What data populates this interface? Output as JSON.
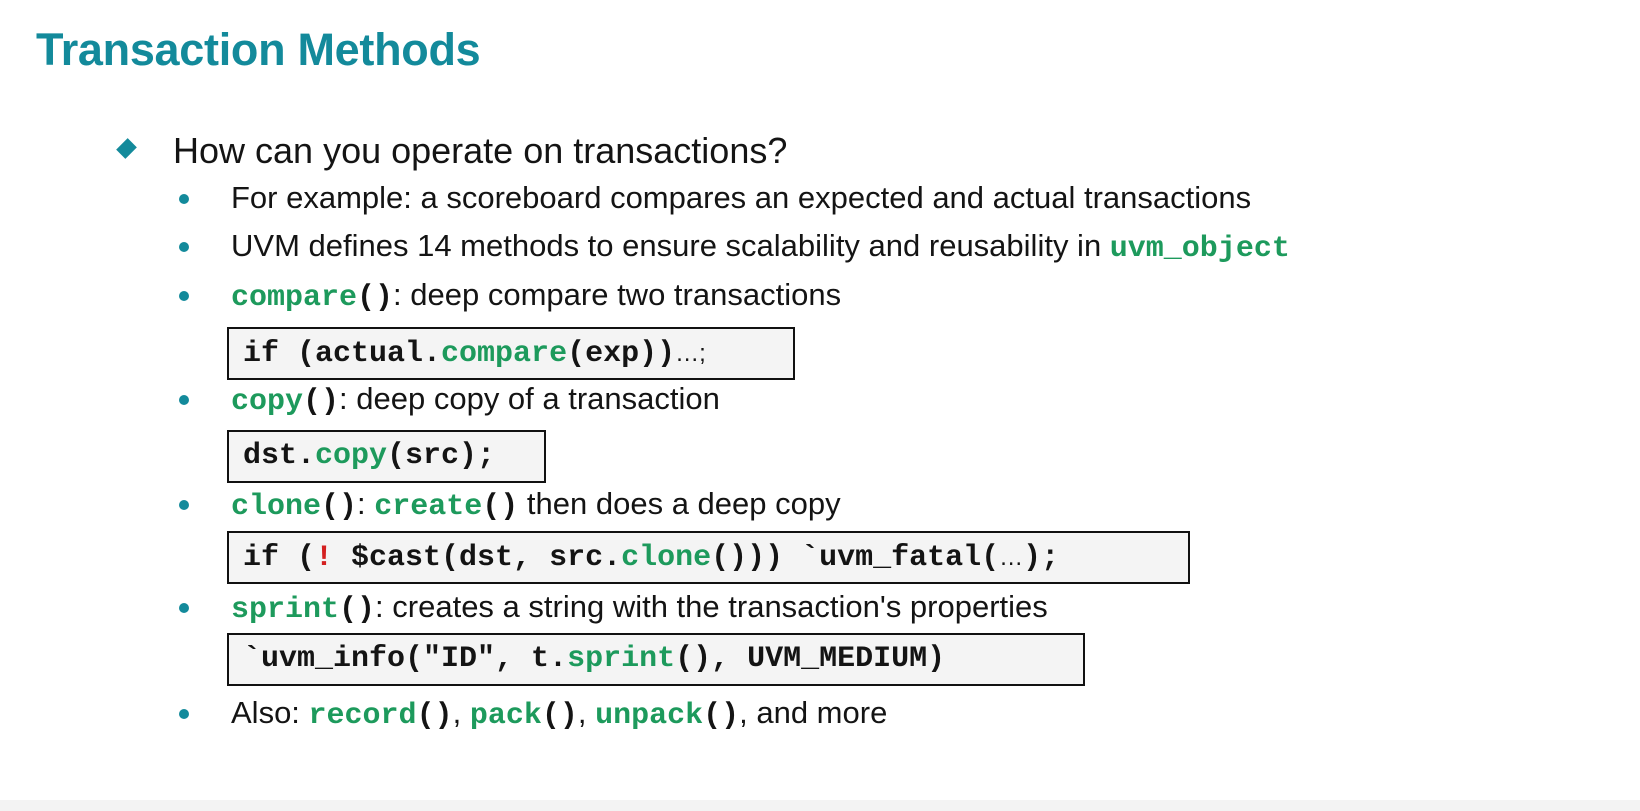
{
  "slide": {
    "title": "Transaction Methods",
    "question": "How can you operate on transactions?",
    "bullets": {
      "example": "For example: a scoreboard compares an expected and actual transactions",
      "uvm_prefix": "UVM defines 14 methods to ensure scalability and reusability in ",
      "uvm_object": "uvm_object",
      "compare_fn": "compare",
      "compare_desc": ": deep compare two transactions",
      "copy_fn": "copy",
      "copy_desc": ": deep copy of a transaction",
      "clone_fn": "clone",
      "clone_sep": ": ",
      "create_fn": "create",
      "clone_desc": " then does a deep copy",
      "sprint_fn": "sprint",
      "sprint_desc": ": creates a string with the transaction's properties",
      "also_prefix": "Also: ",
      "record_fn": "record",
      "pack_fn": "pack",
      "unpack_fn": "unpack",
      "also_suffix": ", and more",
      "parens": "()",
      "comma": ", "
    },
    "code": {
      "compare": {
        "a": "if (actual.",
        "b": "compare",
        "c": "(exp))",
        "d": "…;"
      },
      "copy": {
        "a": "dst.",
        "b": "copy",
        "c": "(src);"
      },
      "clone": {
        "a": "if (",
        "b": "!",
        "c": " $cast(dst, src.",
        "d": "clone",
        "e": "())) `uvm_fatal(",
        "f": "…",
        "g": ");"
      },
      "sprint": {
        "a": "`uvm_info(\"ID\", t.",
        "b": "sprint",
        "c": "(), UVM_MEDIUM)"
      }
    },
    "colors": {
      "title": "#138a9b",
      "code_keyword": "#1d9a5c",
      "code_bang": "#d42020",
      "bullet": "#138a9b"
    }
  }
}
